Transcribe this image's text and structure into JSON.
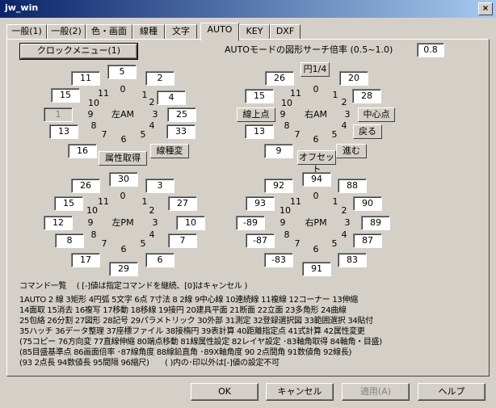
{
  "window": {
    "title": "jw_win",
    "close": "×"
  },
  "tabs": [
    "一般(1)",
    "一般(2)",
    "色・画面",
    "線種",
    "文字",
    "AUTO",
    "KEY",
    "DXF"
  ],
  "header": {
    "clock_menu_button": "クロックメニュー(1)",
    "search_label": "AUTOモードの図形サーチ倍率 (0.5~1.0)",
    "search_value": "0.8"
  },
  "clocks": {
    "left_am": {
      "center": "左AM",
      "fields": {
        "0": "5",
        "1": "2",
        "2": "4",
        "3": "25",
        "4": "33",
        "5": "属性取得",
        "6": "属性取得",
        "7": "16",
        "8": "13",
        "9": "1",
        "10": "15",
        "11": "11"
      },
      "extra": "線種変"
    },
    "right_am": {
      "center": "右AM",
      "top": "円1/4",
      "fields": {
        "0": "26",
        "1": "20",
        "2": "28",
        "3": "中心点",
        "4": "戻る",
        "5": "進む",
        "6": "オフセット",
        "7": "9",
        "8": "13",
        "9": "線上点",
        "10": "15",
        "11": "26"
      }
    },
    "left_pm": {
      "center": "左PM",
      "fields": {
        "0": "30",
        "1": "3",
        "2": "27",
        "3": "10",
        "4": "7",
        "5": "6",
        "6": "29",
        "7": "17",
        "8": "8",
        "9": "12",
        "10": "15",
        "11": "26"
      }
    },
    "right_pm": {
      "center": "右PM",
      "fields": {
        "0": "94",
        "1": "88",
        "2": "90",
        "3": "89",
        "4": "87",
        "5": "83",
        "6": "91",
        "7": "-83",
        "8": "-87",
        "9": "-89",
        "10": "93",
        "11": "92"
      }
    }
  },
  "dial_numbers": [
    "0",
    "1",
    "2",
    "3",
    "4",
    "5",
    "6",
    "7",
    "8",
    "9",
    "10",
    "11"
  ],
  "command_list": {
    "heading": "コマンド一覧　 ( [-]値は指定コマンドを継続、[0]はキャンセル )",
    "lines": [
      "1AUTO 2 線 3矩形 4円弧 5文字 6点 7寸法 8 2線 9中心線 10連続線 11複線 12コーナー 13伸縮",
      "14面取 15消去 16複写 17移動 18移線 19接円 20建具平面 21断面 22立面 23多角形 24曲線",
      "25包絡 26分割 27図形 28記号 29パラメトリック 30外部 31測定 32登録選択図 33範囲選択 34貼付",
      "35ハッチ 36データ整理 37座標ファイル 38接楕円 39表計算 40距離指定点 41式計算 42属性変更",
      "(75コピー 76方向変 77直線伸縮 80端点移動 81線属性設定 82レイヤ設定 ･83軸角取得 84軸角・目盛)",
      "(85目盛基準点 86画面倍率 ･87線角度 88線鉛直角 ･89X軸角度 90 2点間角 91数値角 92線長)",
      "(93 2点長 94数値長 95間隔 96縮尺)　　( )内の･印以外は[-]値の設定不可"
    ]
  },
  "buttons": {
    "ok": "OK",
    "cancel": "キャンセル",
    "apply": "適用(A)",
    "help": "ヘルプ"
  }
}
